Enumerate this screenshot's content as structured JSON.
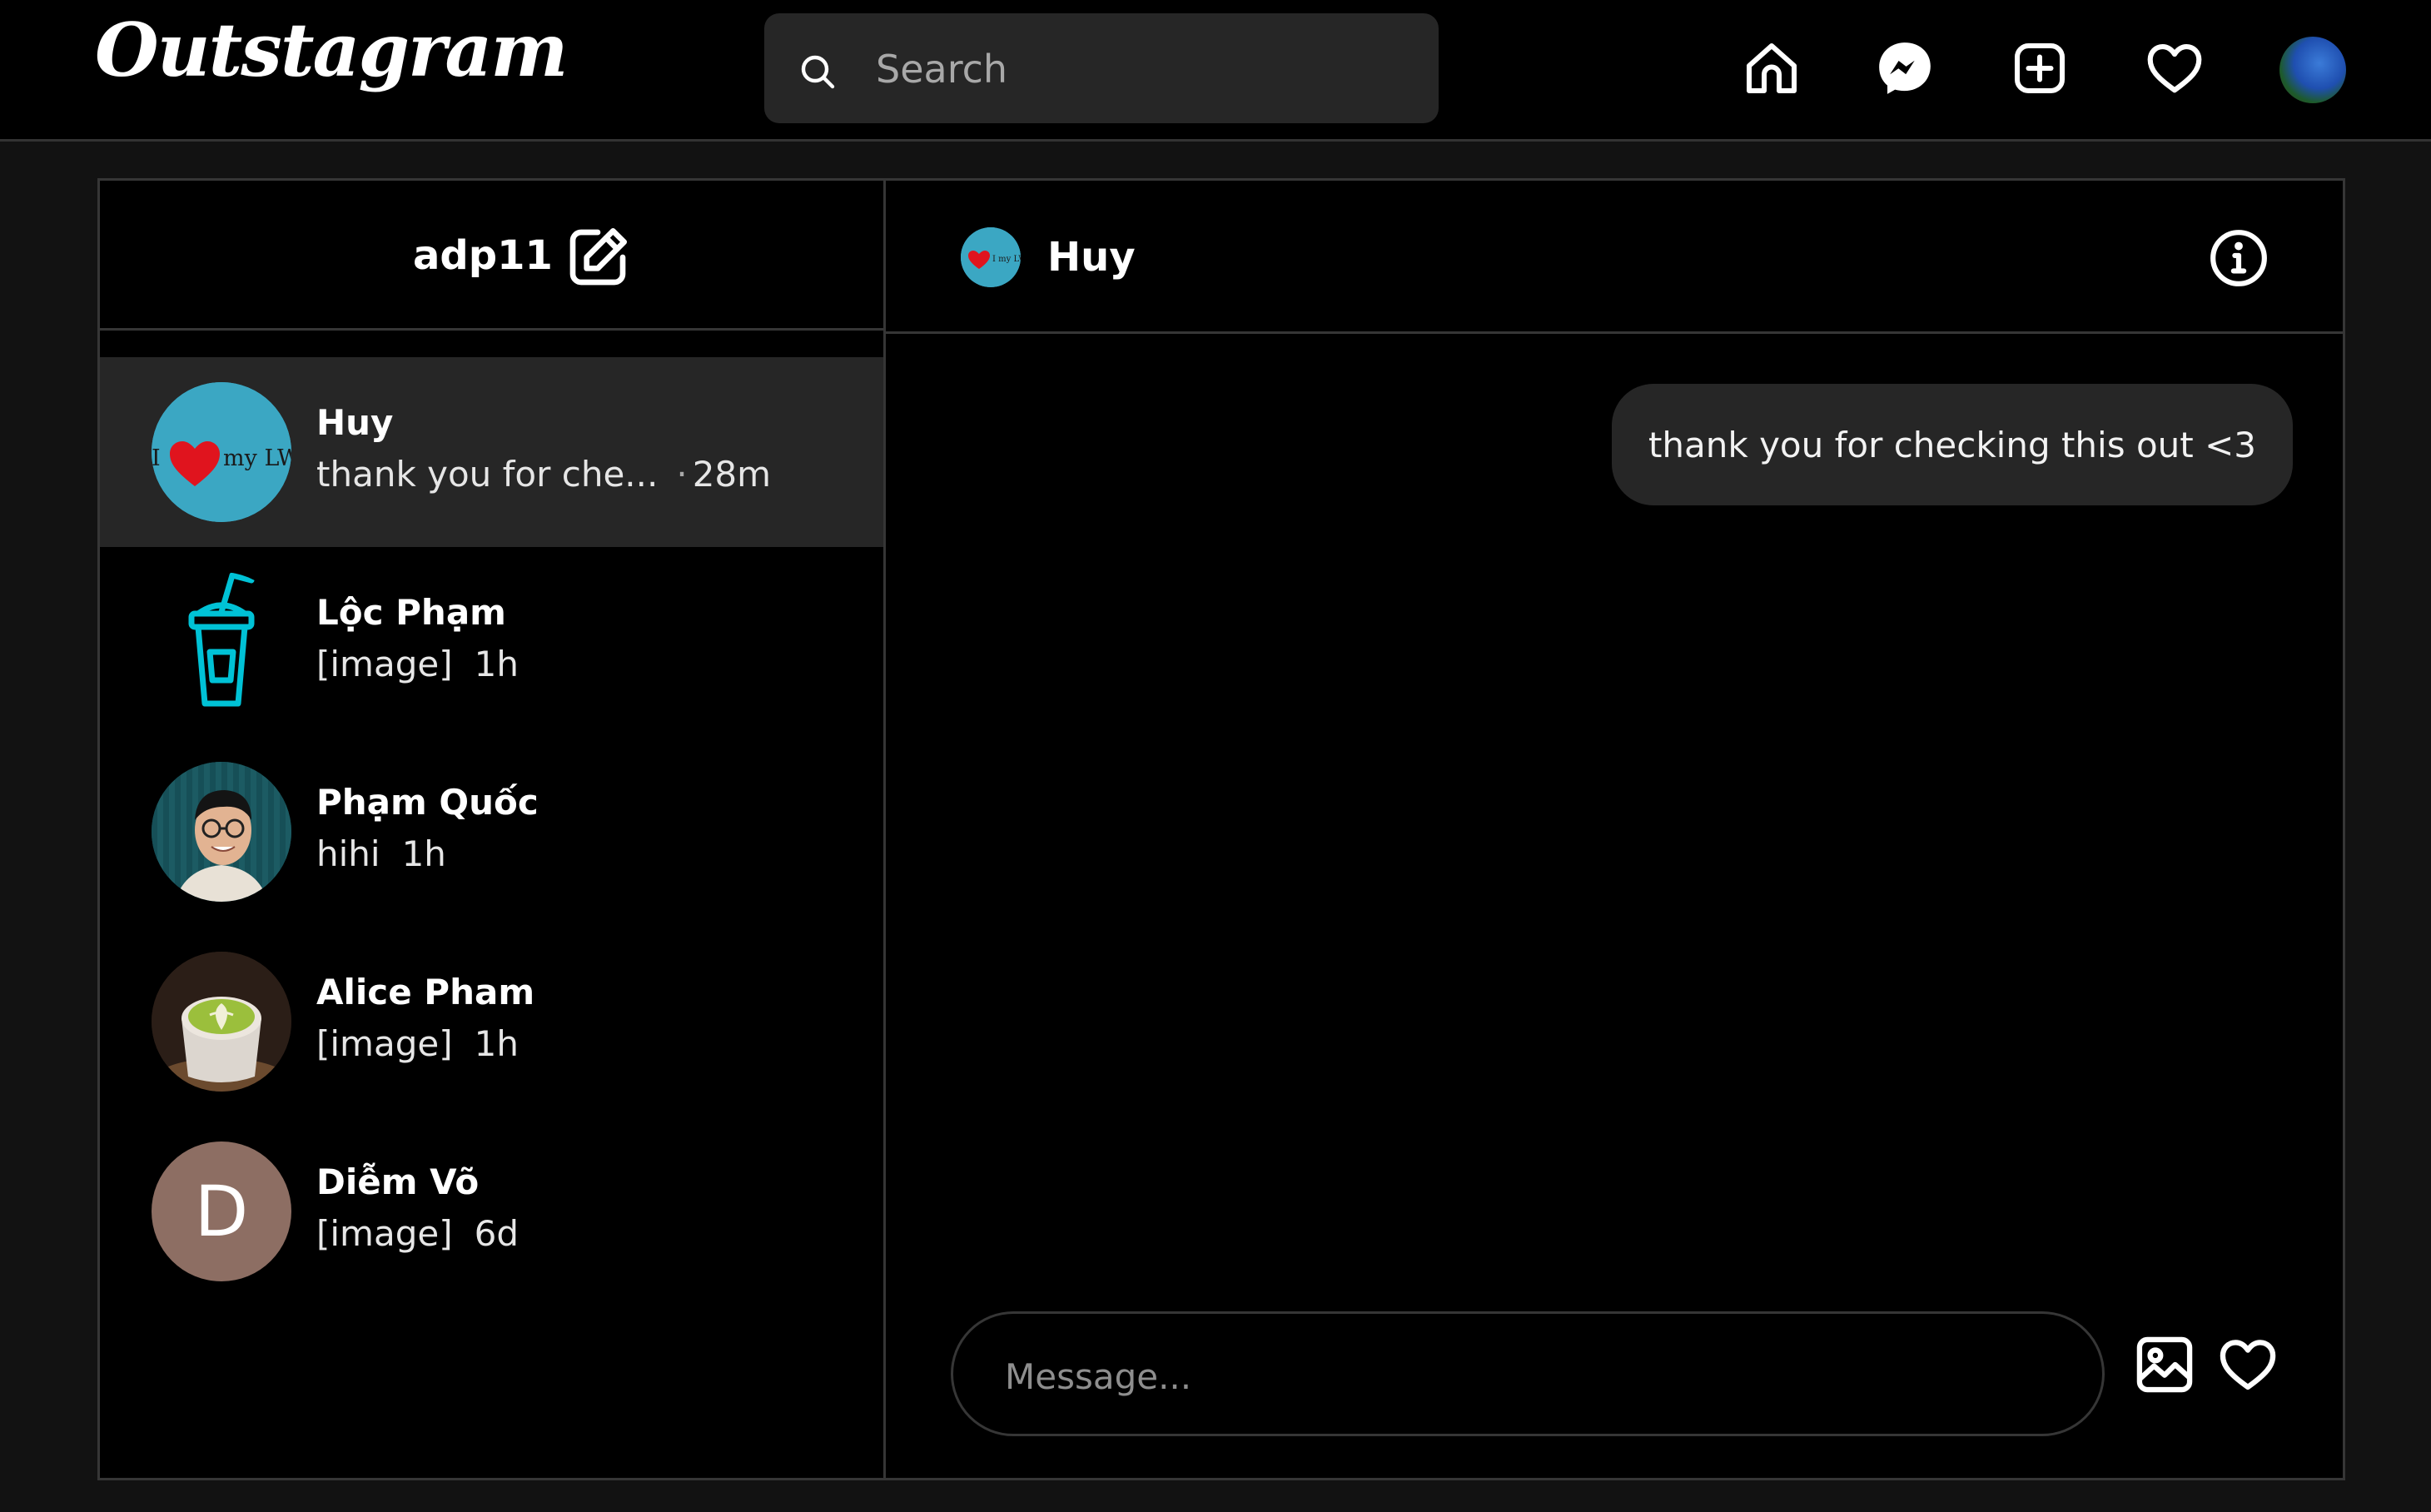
{
  "app": {
    "logo": "Outstagram"
  },
  "search": {
    "placeholder": "Search"
  },
  "nav": {
    "icons": [
      "home-icon",
      "messenger-icon",
      "new-post-icon",
      "heart-icon",
      "profile-avatar"
    ]
  },
  "inbox": {
    "username": "adp11",
    "conversations": [
      {
        "name": "Huy",
        "preview": "thank you for che...",
        "separator": "·",
        "time": "28m",
        "active": true
      },
      {
        "name": "Lộc Phạm",
        "preview": "[image]",
        "time": "1h",
        "active": false
      },
      {
        "name": "Phạm Quốc",
        "preview": "hihi",
        "time": "1h",
        "active": false
      },
      {
        "name": "Alice Pham",
        "preview": "[image]",
        "time": "1h",
        "active": false
      },
      {
        "name": "Diễm Võ",
        "preview": "[image]",
        "time": "6d",
        "avatar_letter": "D",
        "active": false
      }
    ]
  },
  "chat": {
    "recipient": "Huy",
    "avatar_text": "I my LW",
    "messages": [
      {
        "text": "thank you for checking this out <3",
        "from_me": true
      }
    ],
    "input_placeholder": "Message..."
  },
  "colors": {
    "background": "#000000",
    "page": "#121212",
    "surface": "#262626",
    "border": "#363636",
    "avatar_huy": "#3ba7c3",
    "avatar_diem": "#8d6e63",
    "drink_icon": "#00c2d6"
  }
}
